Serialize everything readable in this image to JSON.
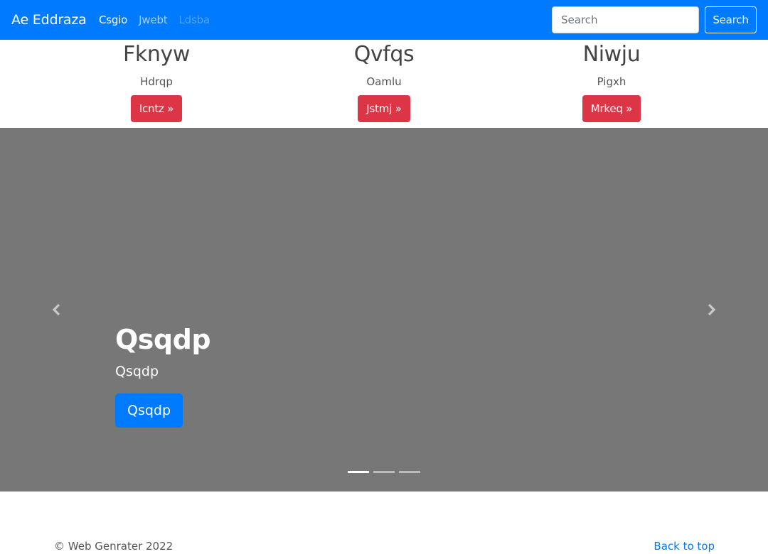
{
  "navbar": {
    "brand": "Ae Eddraza",
    "links": [
      {
        "label": "Csgio",
        "state": "active"
      },
      {
        "label": "Jwebt",
        "state": "normal"
      },
      {
        "label": "Ldsba",
        "state": "disabled"
      }
    ],
    "search_placeholder": "Search",
    "search_button": "Search"
  },
  "features": [
    {
      "title": "Fknyw",
      "text": "Hdrqp",
      "button": "Icntz »"
    },
    {
      "title": "Qvfqs",
      "text": "Oamlu",
      "button": "Jstmj »"
    },
    {
      "title": "Niwju",
      "text": "Pigxh",
      "button": "Mrkeq »"
    }
  ],
  "carousel": {
    "heading": "Qsqdp",
    "subheading": "Qsqdp",
    "button": "Qsqdp",
    "prev_icon": "chevron-left-icon",
    "next_icon": "chevron-right-icon",
    "slide_count": 3,
    "active_index": 0
  },
  "footer": {
    "copyright": "© Web Genrater 2022",
    "back_to_top": "Back to top"
  },
  "colors": {
    "primary": "#007bff",
    "danger": "#dc3545",
    "carousel_bg": "#777777"
  }
}
